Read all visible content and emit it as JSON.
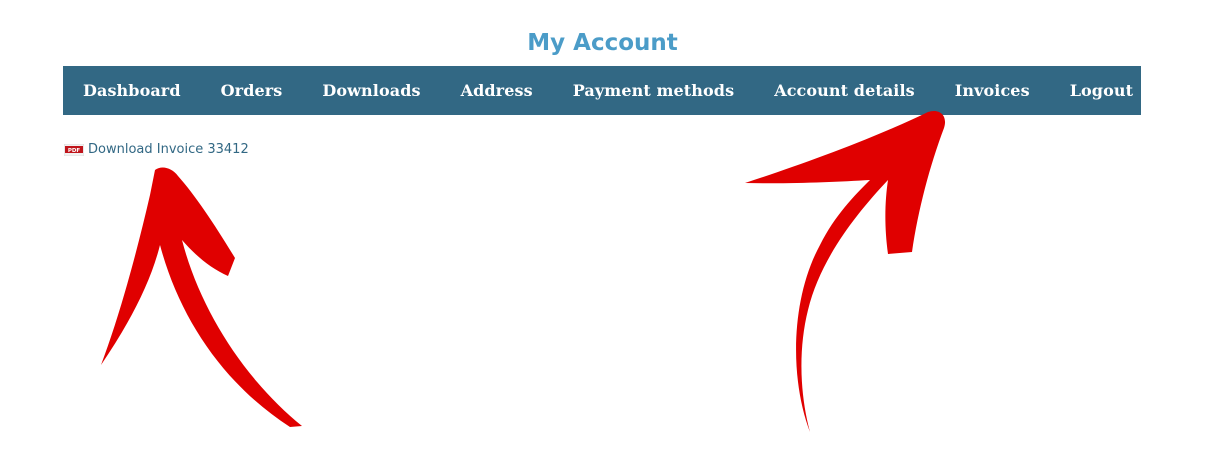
{
  "page": {
    "title": "My Account"
  },
  "nav": {
    "items": [
      {
        "label": "Dashboard"
      },
      {
        "label": "Orders"
      },
      {
        "label": "Downloads"
      },
      {
        "label": "Address"
      },
      {
        "label": "Payment methods"
      },
      {
        "label": "Account details"
      },
      {
        "label": "Invoices"
      },
      {
        "label": "Logout"
      }
    ]
  },
  "content": {
    "download_link": "Download Invoice 33412",
    "pdf_icon_label": "PDF"
  },
  "colors": {
    "title": "#4b9cc8",
    "nav_background": "#326884",
    "nav_text": "#ffffff",
    "link": "#326884",
    "annotation_arrows": "#e00000"
  },
  "icons": {
    "download": "pdf-icon",
    "annotations": "red-arrow-icon"
  }
}
